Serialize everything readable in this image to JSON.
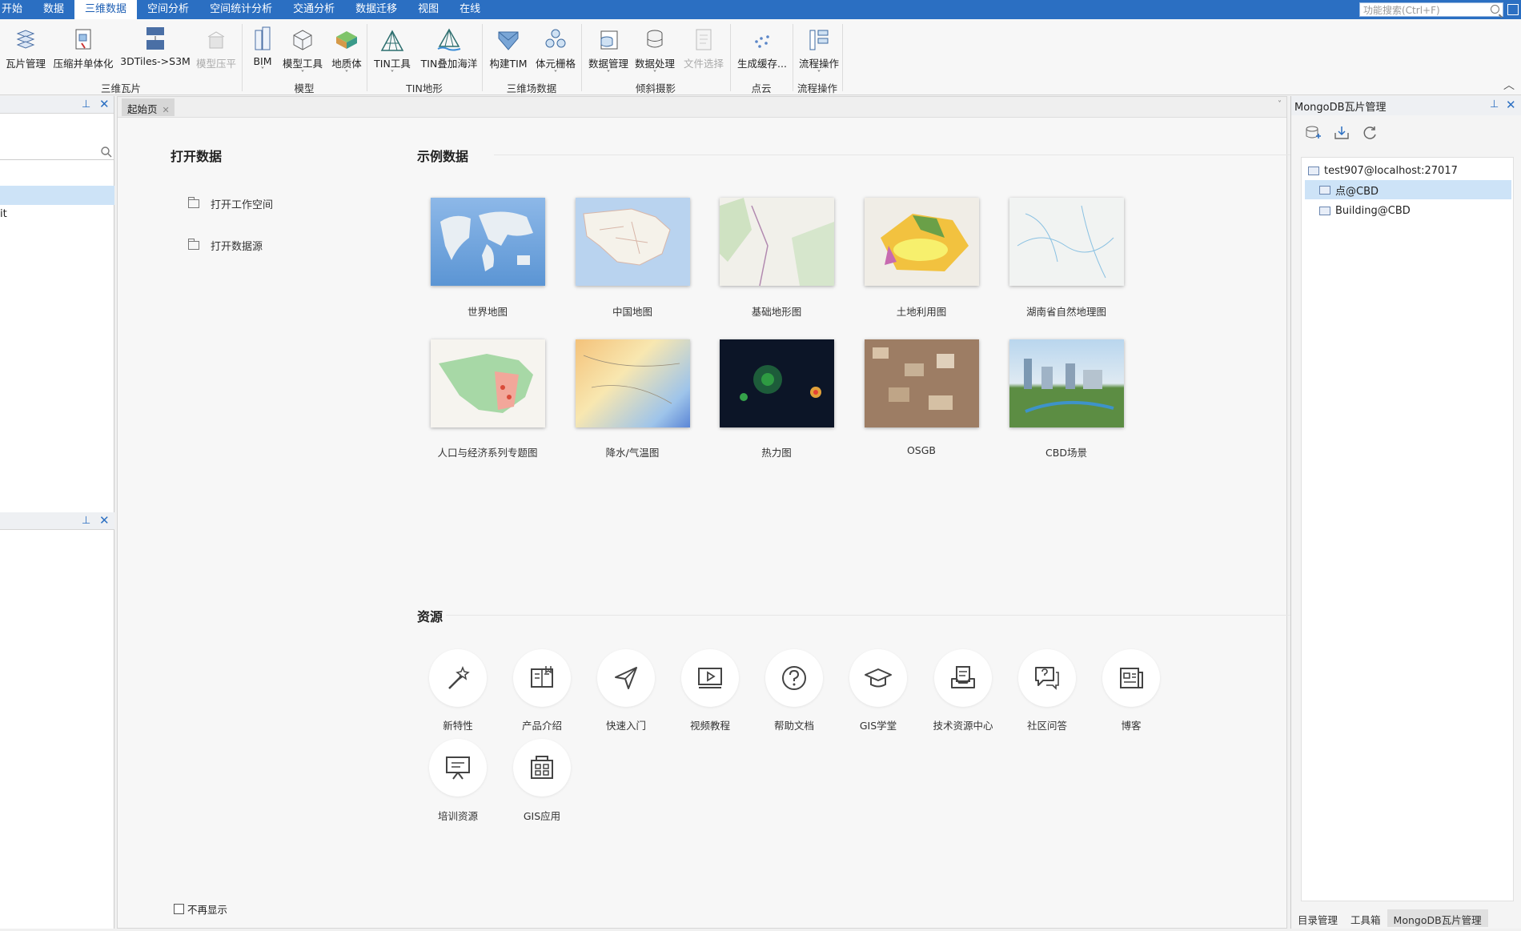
{
  "menu": {
    "tabs": [
      "开始",
      "数据",
      "三维数据",
      "空间分析",
      "空间统计分析",
      "交通分析",
      "数据迁移",
      "视图",
      "在线"
    ],
    "active_index": 2,
    "search_placeholder": "功能搜索(Ctrl+F)"
  },
  "ribbon": {
    "buttons": [
      {
        "label": "瓦片管理",
        "icon": "tile-manage-icon",
        "dropdown": false,
        "disabled": false
      },
      {
        "label": "压缩并单体化",
        "icon": "compress-icon",
        "dropdown": false,
        "disabled": false
      },
      {
        "label": "3DTiles->S3M",
        "icon": "3dtiles-icon",
        "dropdown": false,
        "disabled": false
      },
      {
        "label": "模型压平",
        "icon": "model-flatten-icon",
        "dropdown": false,
        "disabled": true
      },
      {
        "label": "BIM",
        "icon": "bim-icon",
        "dropdown": true,
        "disabled": false
      },
      {
        "label": "模型工具",
        "icon": "model-tools-icon",
        "dropdown": true,
        "disabled": false
      },
      {
        "label": "地质体",
        "icon": "geology-icon",
        "dropdown": true,
        "disabled": false
      },
      {
        "label": "TIN工具",
        "icon": "tin-tools-icon",
        "dropdown": true,
        "disabled": false
      },
      {
        "label": "TIN叠加海洋",
        "icon": "tin-ocean-icon",
        "dropdown": false,
        "disabled": false
      },
      {
        "label": "构建TIM",
        "icon": "build-tim-icon",
        "dropdown": false,
        "disabled": false
      },
      {
        "label": "体元栅格",
        "icon": "voxel-grid-icon",
        "dropdown": true,
        "disabled": false
      },
      {
        "label": "数据管理",
        "icon": "data-manage-icon",
        "dropdown": true,
        "disabled": false
      },
      {
        "label": "数据处理",
        "icon": "data-process-icon",
        "dropdown": true,
        "disabled": false
      },
      {
        "label": "文件选择",
        "icon": "file-select-icon",
        "dropdown": false,
        "disabled": true
      },
      {
        "label": "生成缓存...",
        "icon": "gen-cache-icon",
        "dropdown": false,
        "disabled": false
      },
      {
        "label": "流程操作",
        "icon": "workflow-icon",
        "dropdown": true,
        "disabled": false
      }
    ],
    "groups": [
      "三维瓦片",
      "模型",
      "TIN地形",
      "三维场数据",
      "倾斜摄影",
      "点云",
      "流程操作"
    ]
  },
  "left_panel": {
    "text": "it"
  },
  "doc_tab": {
    "label": "起始页"
  },
  "start_page": {
    "open_data_title": "打开数据",
    "open_workspace": "打开工作空间",
    "open_datasource": "打开数据源",
    "sample_title": "示例数据",
    "samples": [
      "世界地图",
      "中国地图",
      "基础地形图",
      "土地利用图",
      "湖南省自然地理图",
      "人口与经济系列专题图",
      "降水/气温图",
      "热力图",
      "OSGB",
      "CBD场景"
    ],
    "resources_title": "资源",
    "resources": [
      {
        "label": "新特性",
        "icon": "magic-wand-icon"
      },
      {
        "label": "产品介绍",
        "icon": "book-icon"
      },
      {
        "label": "快速入门",
        "icon": "paper-plane-icon"
      },
      {
        "label": "视频教程",
        "icon": "video-icon"
      },
      {
        "label": "帮助文档",
        "icon": "help-icon"
      },
      {
        "label": "GIS学堂",
        "icon": "graduation-cap-icon"
      },
      {
        "label": "技术资源中心",
        "icon": "document-tray-icon"
      },
      {
        "label": "社区问答",
        "icon": "chat-question-icon"
      },
      {
        "label": "博客",
        "icon": "blog-icon"
      },
      {
        "label": "培训资源",
        "icon": "presentation-icon"
      },
      {
        "label": "GIS应用",
        "icon": "apps-icon"
      }
    ],
    "dont_show": "不再显示"
  },
  "right_panel": {
    "title": "MongoDB瓦片管理",
    "tree": {
      "root": "test907@localhost:27017",
      "children": [
        "点@CBD",
        "Building@CBD"
      ],
      "selected_index": 0
    },
    "bottom_tabs": [
      "目录管理",
      "工具箱",
      "MongoDB瓦片管理"
    ],
    "active_bottom": 2
  },
  "colors": {
    "accent": "#2b6fc2",
    "selection": "#cde3f7"
  }
}
